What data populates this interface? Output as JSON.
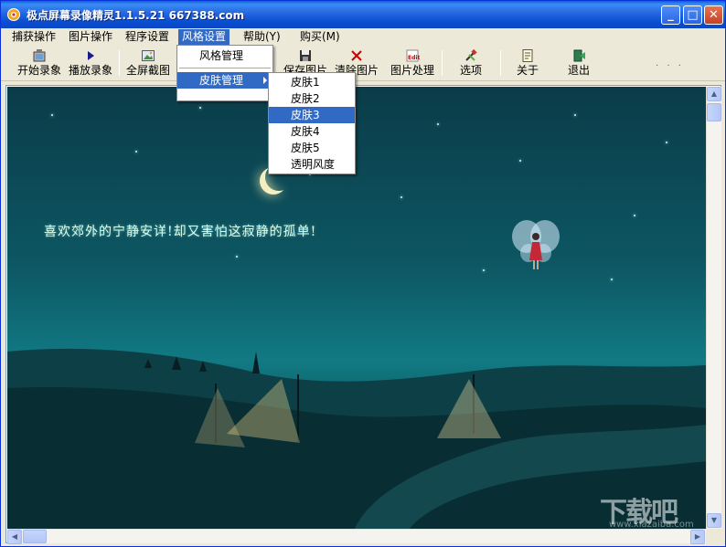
{
  "window": {
    "title": "极点屏幕录像精灵1.1.5.21   667388.com"
  },
  "title_buttons": {
    "minimize": "_",
    "maximize": "□",
    "close": "✕"
  },
  "menubar": {
    "items": [
      {
        "label": "捕获操作"
      },
      {
        "label": "图片操作"
      },
      {
        "label": "程序设置"
      },
      {
        "label": "风格设置"
      },
      {
        "label": "帮助(Y)"
      },
      {
        "label": "购买(M)"
      }
    ]
  },
  "toolbar": {
    "buttons": [
      {
        "label": "开始录象",
        "icon": "record-icon"
      },
      {
        "label": "播放录象",
        "icon": "play-icon"
      },
      {
        "label": "全屏截图",
        "icon": "screenshot-icon"
      },
      {
        "label": "保存图片",
        "icon": "save-icon"
      },
      {
        "label": "清除图片",
        "icon": "delete-icon"
      },
      {
        "label": "图片处理",
        "icon": "edit-icon"
      },
      {
        "label": "选项",
        "icon": "tools-icon"
      },
      {
        "label": "关于",
        "icon": "about-icon"
      },
      {
        "label": "退出",
        "icon": "exit-icon"
      }
    ],
    "more": "· · ·"
  },
  "style_menu": {
    "items": [
      {
        "label": "风格管理"
      },
      {
        "label": "皮肤管理"
      }
    ]
  },
  "skin_menu": {
    "items": [
      {
        "label": "皮肤1"
      },
      {
        "label": "皮肤2"
      },
      {
        "label": "皮肤3"
      },
      {
        "label": "皮肤4"
      },
      {
        "label": "皮肤5"
      },
      {
        "label": "透明风度"
      }
    ],
    "selected": "皮肤3"
  },
  "canvas": {
    "poem": "喜欢郊外的宁静安详!却又害怕这寂静的孤单!"
  },
  "watermark": {
    "main": "下载吧",
    "sub": "www.xiazaiba.com"
  },
  "colors": {
    "menu_highlight": "#316ac5",
    "title_bar": "#0a4fd3"
  }
}
